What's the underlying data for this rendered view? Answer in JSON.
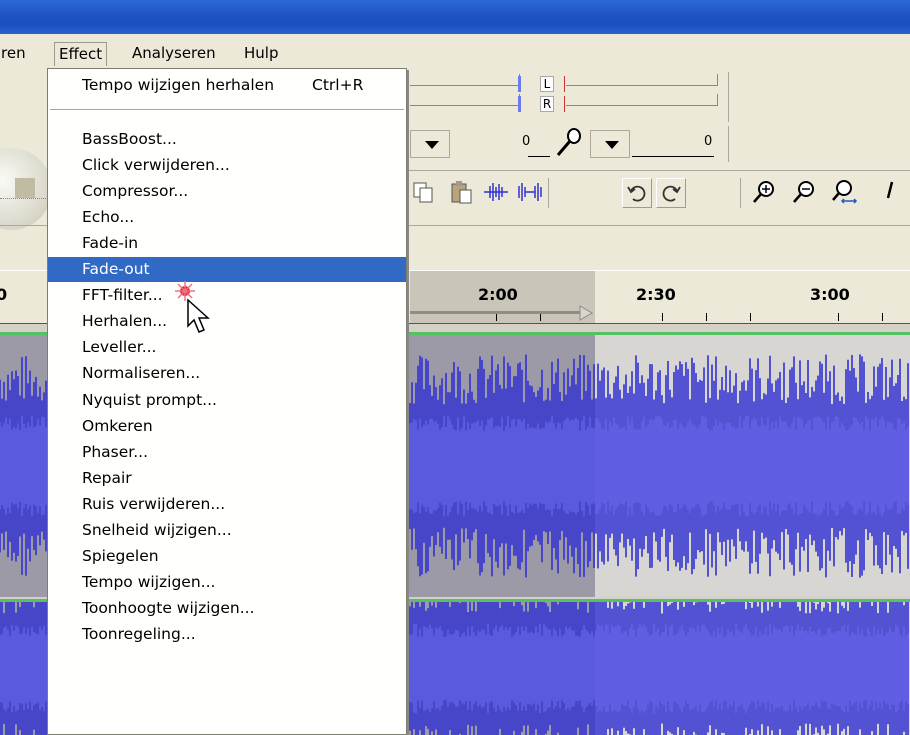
{
  "menubar": {
    "items": [
      {
        "label": "ren"
      },
      {
        "label": "Effect"
      },
      {
        "label": "Analyseren"
      },
      {
        "label": "Hulp"
      }
    ]
  },
  "meter": {
    "left_label": "L",
    "right_label": "R",
    "zero_a": "0",
    "zero_b": "0"
  },
  "ruler": {
    "labels": [
      "0",
      "2:00",
      "2:30",
      "3:00"
    ]
  },
  "effect_menu": {
    "top_item": {
      "label": "Tempo wijzigen herhalen",
      "shortcut": "Ctrl+R"
    },
    "items": [
      {
        "label": "BassBoost..."
      },
      {
        "label": "Click verwijderen..."
      },
      {
        "label": "Compressor..."
      },
      {
        "label": "Echo..."
      },
      {
        "label": "Fade-in"
      },
      {
        "label": "Fade-out"
      },
      {
        "label": "FFT-filter..."
      },
      {
        "label": "Herhalen..."
      },
      {
        "label": "Leveller..."
      },
      {
        "label": "Normaliseren..."
      },
      {
        "label": "Nyquist prompt..."
      },
      {
        "label": "Omkeren"
      },
      {
        "label": "Phaser..."
      },
      {
        "label": "Repair"
      },
      {
        "label": "Ruis verwijderen..."
      },
      {
        "label": "Snelheid wijzigen..."
      },
      {
        "label": "Spiegelen"
      },
      {
        "label": "Tempo wijzigen..."
      },
      {
        "label": "Toonhoogte wijzigen..."
      },
      {
        "label": "Toonregeling..."
      }
    ],
    "selected_item": "Fade-out"
  },
  "colors": {
    "selection_blue": "#316ac5",
    "waveform_blue": "#3232d2",
    "track_green": "#55c262",
    "titlebar_blue": "#1e56c4"
  }
}
